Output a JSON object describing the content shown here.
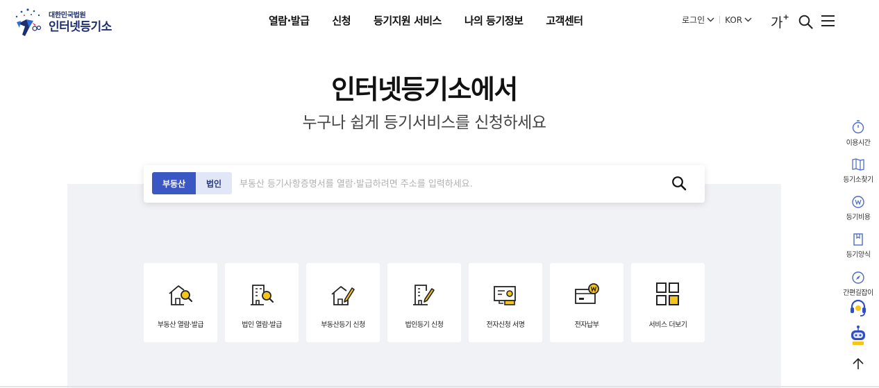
{
  "header": {
    "logo": {
      "sub": "대한민국법원",
      "main": "인터넷등기소"
    },
    "nav": [
      "열람·발급",
      "신청",
      "등기지원 서비스",
      "나의 등기정보",
      "고객센터"
    ],
    "login_label": "로그인",
    "language_label": "KOR",
    "font_size_label": "가",
    "font_size_plus": "+",
    "icons": {
      "search": "search-icon",
      "menu": "hamburger-menu-icon",
      "chevron": "chevron-down-icon"
    }
  },
  "hero": {
    "title": "인터넷등기소에서",
    "subtitle": "누구나 쉽게 등기서비스를 신청하세요"
  },
  "search": {
    "tabs": [
      {
        "label": "부동산",
        "active": true
      },
      {
        "label": "법인",
        "active": false
      }
    ],
    "placeholder": "부동산 등기사항증명서를 열람·발급하려면 주소를 입력하세요.",
    "value": ""
  },
  "services": [
    {
      "label": "부동산 열람·발급",
      "icon": "house-search-icon"
    },
    {
      "label": "법인 열람·발급",
      "icon": "building-search-icon"
    },
    {
      "label": "부동산등기 신청",
      "icon": "house-pencil-icon"
    },
    {
      "label": "법인등기 신청",
      "icon": "building-pencil-icon"
    },
    {
      "label": "전자신청 서명",
      "icon": "e-signature-icon"
    },
    {
      "label": "전자납부",
      "icon": "e-payment-icon"
    },
    {
      "label": "서비스 더보기",
      "icon": "grid-more-icon"
    }
  ],
  "quick_menu": [
    {
      "label": "이용시간",
      "icon": "stopwatch-icon"
    },
    {
      "label": "등기소찾기",
      "icon": "map-book-icon"
    },
    {
      "label": "등기비용",
      "icon": "won-coin-icon"
    },
    {
      "label": "등기양식",
      "icon": "document-icon"
    },
    {
      "label": "간편길잡이",
      "icon": "compass-icon"
    }
  ],
  "quick_icons": {
    "support": "headset-icon",
    "chatbot": "chatbot-robot-icon",
    "top": "arrow-up-icon"
  },
  "colors": {
    "primary": "#3b57c4",
    "tab_inactive": "#e2e7f7",
    "accent_yellow": "#f5c518",
    "background_area": "#f1f2f5"
  }
}
